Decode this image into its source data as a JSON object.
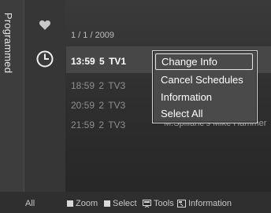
{
  "sidebar": {
    "tab_label": "Programmed"
  },
  "schedule": {
    "date": "1 / 1 / 2009",
    "selected_row": {
      "time": "13:59",
      "day": "5",
      "channel": "TV1"
    },
    "rows": [
      {
        "time": "18:59",
        "day": "2",
        "channel": "TV3"
      },
      {
        "time": "20:59",
        "day": "2",
        "channel": "TV3"
      },
      {
        "time": "21:59",
        "day": "2",
        "channel": "TV3"
      }
    ],
    "program_title_partial": "M.Spillane's Mike Hammer"
  },
  "menu": {
    "items": [
      "Change Info",
      "Cancel Schedules",
      "Information",
      "Select All"
    ],
    "selected_index": 0
  },
  "footer": {
    "all": "All",
    "zoom": "Zoom",
    "select": "Select",
    "tools": "Tools",
    "information": "Information"
  },
  "icons": {
    "favorite": "heart-icon",
    "timer": "clock-icon",
    "row_timer": "timer-icon",
    "tools": "tools-icon",
    "information": "info-icon"
  }
}
